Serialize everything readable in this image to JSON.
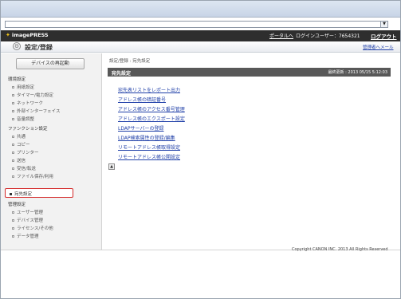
{
  "window": {
    "address_dropdown_glyph": "▼"
  },
  "header": {
    "brand": "imagePRESS",
    "portal_link": "ポータルへ",
    "login_user": "ログインユーザー：7654321",
    "logout": "ログアウト"
  },
  "titlebar": {
    "title": "設定/登録",
    "admin_mail": "管理者へメール"
  },
  "sidebar": {
    "restart_button": "デバイスの再起動",
    "groups": [
      {
        "label": "環境設定",
        "items": [
          "用紙設定",
          "タイマー/電力設定",
          "ネットワーク",
          "外部インターフェイス",
          "音量調整"
        ]
      },
      {
        "label": "ファンクション設定",
        "items": [
          "共通",
          "コピー",
          "プリンター",
          "送信",
          "受信/転送",
          "ファイル保存/利用"
        ]
      },
      {
        "label": "管理設定",
        "items": [
          "ユーザー管理",
          "デバイス管理",
          "ライセンス/その他",
          "データ管理"
        ]
      }
    ],
    "active_item": "宛先設定"
  },
  "content": {
    "breadcrumb": "設定/登録 : 宛先設定",
    "panel_title": "宛先設定",
    "last_updated": "最終更新 : 2013 05/15 5:12:03",
    "links": [
      "宛先表リストをレポート出力",
      "アドレス帳の暗証番号",
      "アドレス帳のアクセス番号管理",
      "アドレス帳のエクスポート設定",
      "LDAPサーバーの登録",
      "LDAP検索属性の登録/編集",
      "リモートアドレス帳取得設定",
      "リモートアドレス帳公開設定"
    ],
    "top_button": "▲"
  },
  "footer": {
    "copyright": "Copyright CANON INC. 2013 All Rights Reserved"
  }
}
